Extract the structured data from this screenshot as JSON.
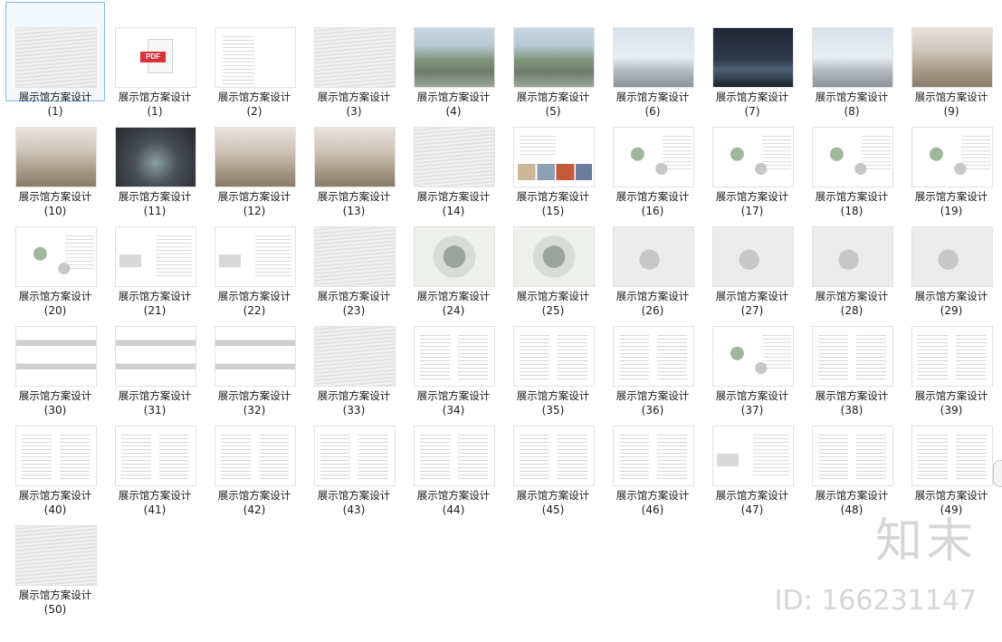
{
  "files": [
    {
      "name": "展示馆方案设计",
      "num": "(1)",
      "thumb": "wave",
      "selected": true
    },
    {
      "name": "展示馆方案设计",
      "num": "(1)",
      "thumb": "pdf",
      "badge": "PDF"
    },
    {
      "name": "展示馆方案设计",
      "num": "(2)",
      "thumb": "text"
    },
    {
      "name": "展示馆方案设计",
      "num": "(3)",
      "thumb": "wave"
    },
    {
      "name": "展示馆方案设计",
      "num": "(4)",
      "thumb": "aerial"
    },
    {
      "name": "展示馆方案设计",
      "num": "(5)",
      "thumb": "aerial"
    },
    {
      "name": "展示馆方案设计",
      "num": "(6)",
      "thumb": "bldg"
    },
    {
      "name": "展示馆方案设计",
      "num": "(7)",
      "thumb": "night"
    },
    {
      "name": "展示馆方案设计",
      "num": "(8)",
      "thumb": "bldg"
    },
    {
      "name": "展示馆方案设计",
      "num": "(9)",
      "thumb": "interior"
    },
    {
      "name": "展示馆方案设计",
      "num": "(10)",
      "thumb": "interior"
    },
    {
      "name": "展示馆方案设计",
      "num": "(11)",
      "thumb": "dark"
    },
    {
      "name": "展示馆方案设计",
      "num": "(12)",
      "thumb": "interior"
    },
    {
      "name": "展示馆方案设计",
      "num": "(13)",
      "thumb": "interior"
    },
    {
      "name": "展示馆方案设计",
      "num": "(14)",
      "thumb": "wave"
    },
    {
      "name": "展示馆方案设计",
      "num": "(15)",
      "thumb": "photos"
    },
    {
      "name": "展示馆方案设计",
      "num": "(16)",
      "thumb": "diagram"
    },
    {
      "name": "展示馆方案设计",
      "num": "(17)",
      "thumb": "diagram"
    },
    {
      "name": "展示馆方案设计",
      "num": "(18)",
      "thumb": "diagram"
    },
    {
      "name": "展示馆方案设计",
      "num": "(19)",
      "thumb": "diagram"
    },
    {
      "name": "展示馆方案设计",
      "num": "(20)",
      "thumb": "diagram"
    },
    {
      "name": "展示馆方案设计",
      "num": "(21)",
      "thumb": "mixed"
    },
    {
      "name": "展示馆方案设计",
      "num": "(22)",
      "thumb": "mixed"
    },
    {
      "name": "展示馆方案设计",
      "num": "(23)",
      "thumb": "wave"
    },
    {
      "name": "展示馆方案设计",
      "num": "(24)",
      "thumb": "plan"
    },
    {
      "name": "展示馆方案设计",
      "num": "(25)",
      "thumb": "plan"
    },
    {
      "name": "展示馆方案设计",
      "num": "(26)",
      "thumb": "site"
    },
    {
      "name": "展示馆方案设计",
      "num": "(27)",
      "thumb": "site"
    },
    {
      "name": "展示馆方案设计",
      "num": "(28)",
      "thumb": "site"
    },
    {
      "name": "展示馆方案设计",
      "num": "(29)",
      "thumb": "site"
    },
    {
      "name": "展示馆方案设计",
      "num": "(30)",
      "thumb": "elev"
    },
    {
      "name": "展示馆方案设计",
      "num": "(31)",
      "thumb": "elev"
    },
    {
      "name": "展示馆方案设计",
      "num": "(32)",
      "thumb": "elev"
    },
    {
      "name": "展示馆方案设计",
      "num": "(33)",
      "thumb": "wave"
    },
    {
      "name": "展示馆方案设计",
      "num": "(34)",
      "thumb": "text2"
    },
    {
      "name": "展示馆方案设计",
      "num": "(35)",
      "thumb": "text2"
    },
    {
      "name": "展示馆方案设计",
      "num": "(36)",
      "thumb": "text2"
    },
    {
      "name": "展示馆方案设计",
      "num": "(37)",
      "thumb": "diagram"
    },
    {
      "name": "展示馆方案设计",
      "num": "(38)",
      "thumb": "text2"
    },
    {
      "name": "展示馆方案设计",
      "num": "(39)",
      "thumb": "text2"
    },
    {
      "name": "展示馆方案设计",
      "num": "(40)",
      "thumb": "text2"
    },
    {
      "name": "展示馆方案设计",
      "num": "(41)",
      "thumb": "text2"
    },
    {
      "name": "展示馆方案设计",
      "num": "(42)",
      "thumb": "text2"
    },
    {
      "name": "展示馆方案设计",
      "num": "(43)",
      "thumb": "text2"
    },
    {
      "name": "展示馆方案设计",
      "num": "(44)",
      "thumb": "text2"
    },
    {
      "name": "展示馆方案设计",
      "num": "(45)",
      "thumb": "text2"
    },
    {
      "name": "展示馆方案设计",
      "num": "(46)",
      "thumb": "text2"
    },
    {
      "name": "展示馆方案设计",
      "num": "(47)",
      "thumb": "mixed"
    },
    {
      "name": "展示馆方案设计",
      "num": "(48)",
      "thumb": "text2"
    },
    {
      "name": "展示馆方案设计",
      "num": "(49)",
      "thumb": "text2"
    },
    {
      "name": "展示馆方案设计",
      "num": "(50)",
      "thumb": "wave"
    }
  ],
  "watermark": {
    "logo": "知末",
    "id": "ID: 166231147"
  },
  "colors": {
    "selection": "#7eb4ea",
    "pdf_badge": "#d9333a"
  }
}
